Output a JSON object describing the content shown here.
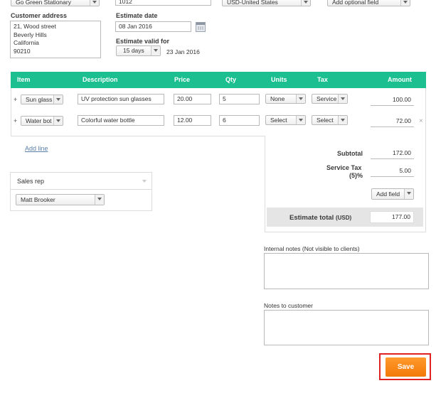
{
  "top": {
    "company_select": "Go Green Stationary",
    "number_value": "1012",
    "currency_select": "USD-United States",
    "optional_field_select": "Add optional field"
  },
  "customer": {
    "label": "Customer address",
    "lines": [
      "21, Wood street",
      "Beverly Hills",
      "California",
      "90210"
    ]
  },
  "estimate": {
    "date_label": "Estimate date",
    "date_value": "08 Jan 2016",
    "valid_label": "Estimate valid for",
    "valid_select": "15 days",
    "valid_until": "23 Jan 2016"
  },
  "table": {
    "headers": {
      "item": "Item",
      "description": "Description",
      "price": "Price",
      "qty": "Qty",
      "units": "Units",
      "tax": "Tax",
      "amount": "Amount"
    },
    "rows": [
      {
        "plus": "+",
        "item": "Sun glass",
        "description": "UV protection sun glasses",
        "price": "20.00",
        "qty": "5",
        "units": "None",
        "tax": "Service",
        "amount": "100.00"
      },
      {
        "plus": "+",
        "item": "Water bot",
        "description": "Colorful water bottle",
        "price": "12.00",
        "qty": "6",
        "units": "Select",
        "tax": "Select",
        "amount": "72.00",
        "remove": "×"
      }
    ],
    "add_line": "Add line"
  },
  "totals": {
    "subtotal_label": "Subtotal",
    "subtotal_value": "172.00",
    "tax_label_1": "Service Tax",
    "tax_label_2": "(5)%",
    "tax_value": "5.00",
    "add_field": "Add field",
    "total_label": "Estimate total",
    "total_currency": "(USD)",
    "total_value": "177.00"
  },
  "sales_rep": {
    "title": "Sales rep",
    "selected": "Matt Brooker"
  },
  "notes": {
    "internal_label": "Internal notes (Not visible to clients)",
    "customer_label": "Notes to customer"
  },
  "save_label": "Save"
}
